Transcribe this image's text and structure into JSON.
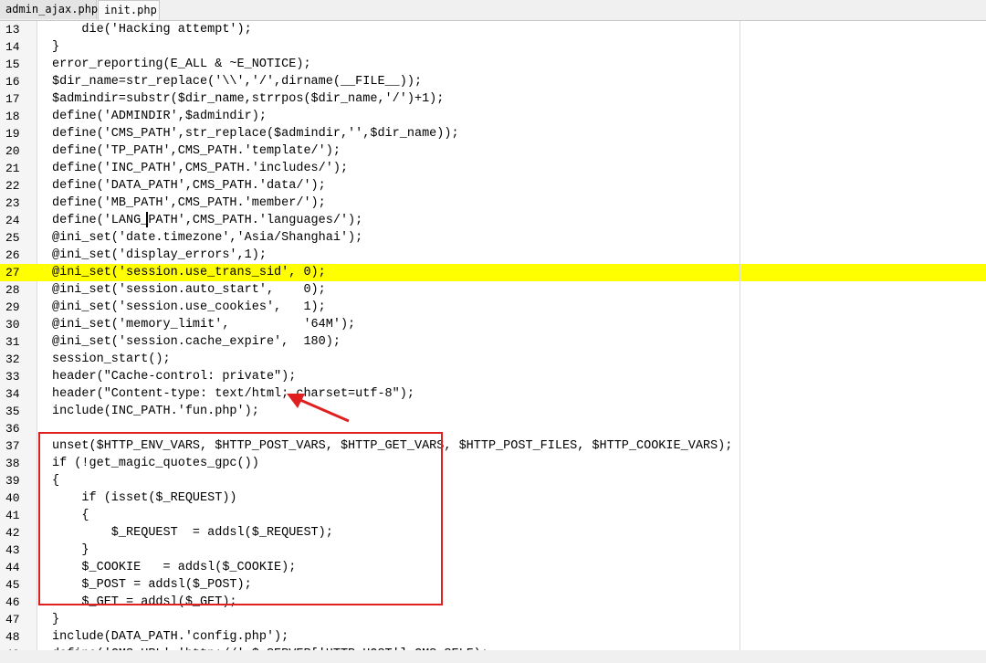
{
  "tabs": [
    {
      "label": "admin_ajax.php",
      "active": false
    },
    {
      "label": "init.php",
      "active": true
    }
  ],
  "highlight_color": "#ffff00",
  "annotation_box_color": "#e02020",
  "lines": [
    {
      "n": "13",
      "text": "    die('Hacking attempt');"
    },
    {
      "n": "14",
      "text": "}"
    },
    {
      "n": "15",
      "text": "error_reporting(E_ALL & ~E_NOTICE);"
    },
    {
      "n": "16",
      "text": "$dir_name=str_replace('\\\\','/',dirname(__FILE__));"
    },
    {
      "n": "17",
      "text": "$admindir=substr($dir_name,strrpos($dir_name,'/')+1);"
    },
    {
      "n": "18",
      "text": "define('ADMINDIR',$admindir);"
    },
    {
      "n": "19",
      "text": "define('CMS_PATH',str_replace($admindir,'',$dir_name));"
    },
    {
      "n": "20",
      "text": "define('TP_PATH',CMS_PATH.'template/');"
    },
    {
      "n": "21",
      "text": "define('INC_PATH',CMS_PATH.'includes/');"
    },
    {
      "n": "22",
      "text": "define('DATA_PATH',CMS_PATH.'data/');"
    },
    {
      "n": "23",
      "text": "define('MB_PATH',CMS_PATH.'member/');"
    },
    {
      "n": "24",
      "text": "define('LANG_PATH',CMS_PATH.'languages/');"
    },
    {
      "n": "25",
      "text": "@ini_set('date.timezone','Asia/Shanghai');"
    },
    {
      "n": "26",
      "text": "@ini_set('display_errors',1);"
    },
    {
      "n": "27",
      "text": "@ini_set('session.use_trans_sid', 0);",
      "highlight": true
    },
    {
      "n": "28",
      "text": "@ini_set('session.auto_start',    0);"
    },
    {
      "n": "29",
      "text": "@ini_set('session.use_cookies',   1);"
    },
    {
      "n": "30",
      "text": "@ini_set('memory_limit',          '64M');"
    },
    {
      "n": "31",
      "text": "@ini_set('session.cache_expire',  180);"
    },
    {
      "n": "32",
      "text": "session_start();"
    },
    {
      "n": "33",
      "text": "header(\"Cache-control: private\");"
    },
    {
      "n": "34",
      "text": "header(\"Content-type: text/html; charset=utf-8\");"
    },
    {
      "n": "35",
      "text": "include(INC_PATH.'fun.php');"
    },
    {
      "n": "36",
      "text": ""
    },
    {
      "n": "37",
      "text": "unset($HTTP_ENV_VARS, $HTTP_POST_VARS, $HTTP_GET_VARS, $HTTP_POST_FILES, $HTTP_COOKIE_VARS);"
    },
    {
      "n": "38",
      "text": "if (!get_magic_quotes_gpc())"
    },
    {
      "n": "39",
      "text": "{"
    },
    {
      "n": "40",
      "text": "    if (isset($_REQUEST))"
    },
    {
      "n": "41",
      "text": "    {"
    },
    {
      "n": "42",
      "text": "        $_REQUEST  = addsl($_REQUEST);"
    },
    {
      "n": "43",
      "text": "    }"
    },
    {
      "n": "44",
      "text": "    $_COOKIE   = addsl($_COOKIE);"
    },
    {
      "n": "45",
      "text": "    $_POST = addsl($_POST);"
    },
    {
      "n": "46",
      "text": "    $_GET = addsl($_GET);"
    },
    {
      "n": "47",
      "text": "}"
    },
    {
      "n": "48",
      "text": "include(DATA_PATH.'config.php');"
    },
    {
      "n": "49",
      "text": "define('CMS_URL','http://'.$_SERVER['HTTP_HOST'].CMS_SELF);"
    }
  ]
}
